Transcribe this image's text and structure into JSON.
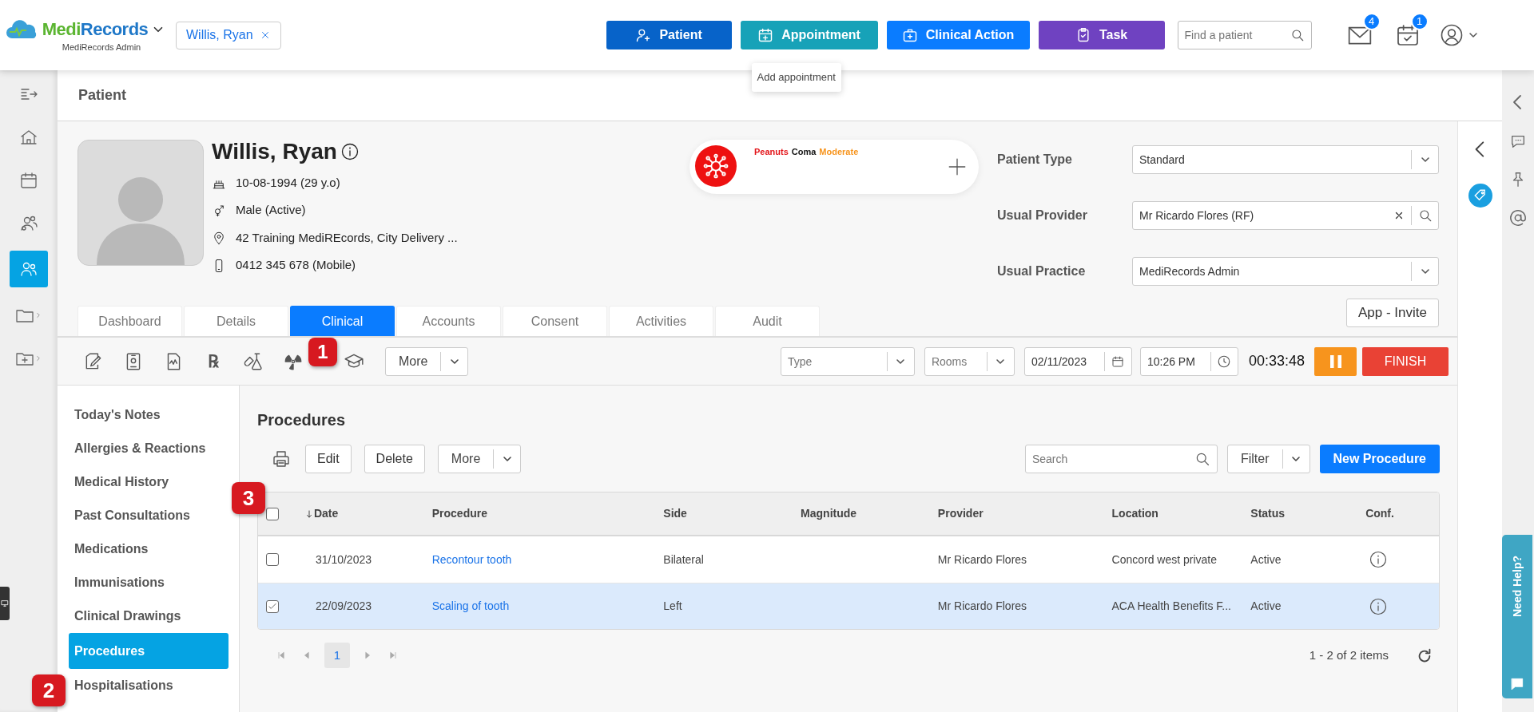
{
  "app": {
    "brand": [
      {
        "text": "Medi",
        "color": "#5bb531"
      },
      {
        "text": "Records",
        "color": "#1f78c8"
      }
    ],
    "subtitle": "MediRecords Admin"
  },
  "open_patient_chip": {
    "label": "Willis, Ryan"
  },
  "header_actions": [
    {
      "label": "Patient",
      "kind": "patient",
      "color": "#0763c9"
    },
    {
      "label": "Appointment",
      "kind": "appointment",
      "color": "#17a2b8"
    },
    {
      "label": "Clinical Action",
      "kind": "clinical",
      "color": "#0a7cff"
    },
    {
      "label": "Task",
      "kind": "task",
      "color": "#6f42c1"
    }
  ],
  "tooltip": "Add appointment",
  "patient_search": {
    "placeholder": "Find a patient"
  },
  "notifications": [
    {
      "kind": "mail",
      "count": "4"
    },
    {
      "kind": "calendar",
      "count": "1"
    }
  ],
  "page_title": "Patient",
  "left_rail": [
    {
      "kind": "expand",
      "selected": false
    },
    {
      "kind": "home",
      "selected": false
    },
    {
      "kind": "calendar",
      "selected": false
    },
    {
      "kind": "contacts",
      "selected": false
    },
    {
      "kind": "patients",
      "selected": true
    },
    {
      "kind": "folder",
      "selected": false
    },
    {
      "kind": "folder-add",
      "selected": false
    }
  ],
  "patient": {
    "name": "Willis, Ryan",
    "details": [
      {
        "kind": "birthday",
        "text": "10-08-1994 (29 y.o)"
      },
      {
        "kind": "gender",
        "text": "Male (Active)"
      },
      {
        "kind": "address",
        "text": "42 Training MediREcords, City Delivery ..."
      },
      {
        "kind": "phone",
        "text": "0412 345 678 (Mobile)"
      }
    ]
  },
  "alert": {
    "parts": [
      {
        "text": "Peanuts",
        "color": "#e3161b"
      },
      {
        "text": "Coma",
        "color": "#111111"
      },
      {
        "text": "Moderate",
        "color": "#f7941d"
      }
    ]
  },
  "fields": [
    {
      "label": "Patient Type",
      "value": "Standard",
      "kind": "select"
    },
    {
      "label": "Usual Provider",
      "value": "Mr Ricardo Flores (RF)",
      "kind": "lookup"
    },
    {
      "label": "Usual Practice",
      "value": "MediRecords Admin",
      "kind": "select"
    }
  ],
  "app_invite": "App - Invite",
  "tabs": [
    {
      "label": "Dashboard",
      "selected": false
    },
    {
      "label": "Details",
      "selected": false
    },
    {
      "label": "Clinical",
      "selected": true
    },
    {
      "label": "Accounts",
      "selected": false
    },
    {
      "label": "Consent",
      "selected": false
    },
    {
      "label": "Activities",
      "selected": false
    },
    {
      "label": "Audit",
      "selected": false
    }
  ],
  "toolbar": {
    "tools": [
      {
        "kind": "note"
      },
      {
        "kind": "badge"
      },
      {
        "kind": "chart"
      },
      {
        "kind": "rx",
        "glyph": "℞"
      },
      {
        "kind": "lab"
      },
      {
        "kind": "radiation"
      },
      {
        "kind": "education"
      }
    ],
    "more": "More",
    "type": {
      "placeholder": "Type"
    },
    "rooms": {
      "placeholder": "Rooms"
    },
    "date": "02/11/2023",
    "time": "10:26 PM",
    "timer": "00:33:48",
    "finish": "FINISH"
  },
  "side_nav": [
    {
      "label": "Today's Notes",
      "selected": false
    },
    {
      "label": "Allergies & Reactions",
      "selected": false
    },
    {
      "label": "Medical History",
      "selected": false
    },
    {
      "label": "Past Consultations",
      "selected": false
    },
    {
      "label": "Medications",
      "selected": false
    },
    {
      "label": "Immunisations",
      "selected": false
    },
    {
      "label": "Clinical Drawings",
      "selected": false
    },
    {
      "label": "Procedures",
      "selected": true
    },
    {
      "label": "Hospitalisations",
      "selected": false
    }
  ],
  "section": {
    "title": "Procedures",
    "actions": [
      "Edit",
      "Delete"
    ],
    "more": "More",
    "search": {
      "placeholder": "Search"
    },
    "filter": "Filter",
    "new_button": "New Procedure"
  },
  "table": {
    "select_all": {
      "checked": false
    },
    "columns": [
      {
        "label": "Date",
        "sorted": true
      },
      {
        "label": "Procedure",
        "sorted": false
      },
      {
        "label": "Side",
        "sorted": false
      },
      {
        "label": "Magnitude",
        "sorted": false
      },
      {
        "label": "Provider",
        "sorted": false
      },
      {
        "label": "Location",
        "sorted": false
      },
      {
        "label": "Status",
        "sorted": false
      },
      {
        "label": "Conf.",
        "sorted": false
      }
    ],
    "rows": [
      {
        "selected": false,
        "date": "31/10/2023",
        "procedure": "Recontour tooth",
        "side": "Bilateral",
        "provider": "Mr Ricardo Flores",
        "location": "Concord west private",
        "status": "Active"
      },
      {
        "selected": true,
        "date": "22/09/2023",
        "procedure": "Scaling of tooth",
        "side": "Left",
        "provider": "Mr Ricardo Flores",
        "location": "ACA Health Benefits F...",
        "status": "Active"
      }
    ]
  },
  "pager": {
    "pages": [
      {
        "label": "1",
        "selected": true
      }
    ],
    "summary": "1 - 2 of 2 items"
  },
  "callouts": [
    {
      "label": "1",
      "kind": "toolbar"
    },
    {
      "label": "2",
      "kind": "sidenav"
    },
    {
      "label": "3",
      "kind": "print"
    }
  ],
  "help_tab": "Need Help?"
}
